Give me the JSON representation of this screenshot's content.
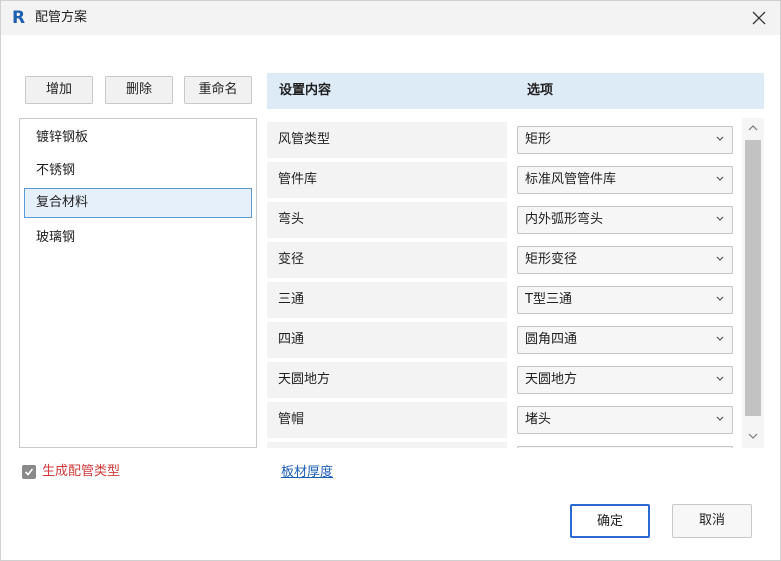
{
  "window": {
    "app_icon_letter": "R",
    "title": "配管方案"
  },
  "toolbar": {
    "add_label": "增加",
    "delete_label": "删除",
    "rename_label": "重命名"
  },
  "materials": [
    {
      "label": "镀锌钢板",
      "selected": false
    },
    {
      "label": "不锈钢",
      "selected": false
    },
    {
      "label": "复合材料",
      "selected": true
    },
    {
      "label": "玻璃钢",
      "selected": false
    }
  ],
  "table": {
    "headers": {
      "content": "设置内容",
      "option": "选项"
    },
    "rows": [
      {
        "label": "风管类型",
        "value": "矩形"
      },
      {
        "label": "管件库",
        "value": "标准风管管件库"
      },
      {
        "label": "弯头",
        "value": "内外弧形弯头"
      },
      {
        "label": "变径",
        "value": "矩形变径"
      },
      {
        "label": "三通",
        "value": "T型三通"
      },
      {
        "label": "四通",
        "value": "圆角四通"
      },
      {
        "label": "天圆地方",
        "value": "天圆地方"
      },
      {
        "label": "管帽",
        "value": "堵头"
      },
      {
        "label": "",
        "value": ""
      }
    ]
  },
  "footer": {
    "generate_checkbox_label": "生成配管类型",
    "generate_checked": true,
    "board_thickness_link": "板材厚度",
    "ok_label": "确定",
    "cancel_label": "取消"
  },
  "colors": {
    "header_bg": "#ddebf7",
    "selected_border": "#5b9bd5",
    "link": "#1d5fb8",
    "checkbox_label": "#d23c3c",
    "primary_border": "#2a6ad1"
  }
}
